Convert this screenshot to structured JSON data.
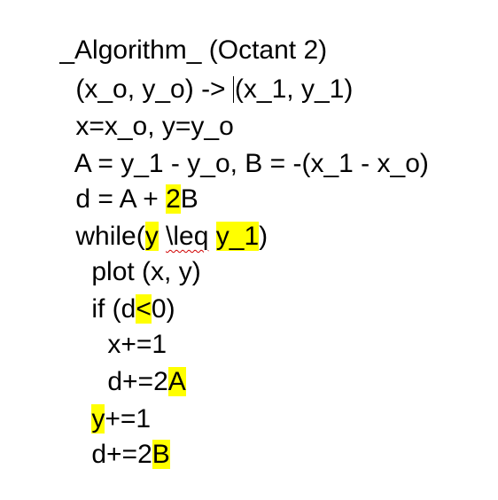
{
  "document": {
    "lines": [
      {
        "text": "_Algorithm_ (Octant 2)"
      },
      {
        "part1": "(x_o, y_o) -> ",
        "part2": "(x_1, y_1)"
      },
      {
        "text": "x=x_o, y=y_o"
      },
      {
        "text": "A = y_1 - y_o, B = -(x_1 - x_o)"
      },
      {
        "part1": "d = A + ",
        "hl": "2",
        "part2": "B"
      },
      {
        "part1": "while(",
        "hl1": "y",
        "sp": " ",
        "squiggle": "\\leq",
        "sp2": " ",
        "hl2": "y_1",
        "part2": ")"
      },
      {
        "text": "plot (x, y)"
      },
      {
        "part1": "if (d",
        "hl": "<",
        "part2": "0)"
      },
      {
        "text": "x+=1"
      },
      {
        "part1": "d+=2",
        "hl": "A"
      },
      {
        "hl": "y",
        "part2": "+=1"
      },
      {
        "part1": "d+=2",
        "hl": "B"
      }
    ],
    "highlight_color": "#ffff00"
  }
}
